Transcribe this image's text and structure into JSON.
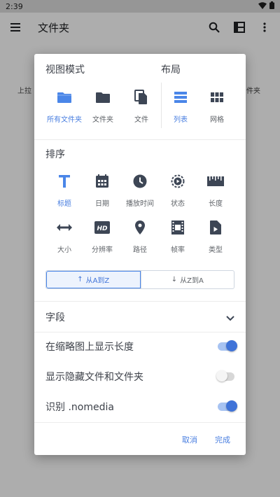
{
  "status_bar": {
    "time": "2:39",
    "icons": [
      "wifi-icon",
      "battery-icon"
    ]
  },
  "app_bar": {
    "title": "文件夹",
    "icons": [
      "menu-icon",
      "search-icon",
      "layout-icon",
      "more-vert-icon"
    ]
  },
  "background": {
    "left_text": "上拉",
    "right_text": "件夹"
  },
  "dialog": {
    "view_mode": {
      "title": "视图模式",
      "items": [
        {
          "label": "所有文件夹",
          "icon": "folder-filled-icon",
          "active": true
        },
        {
          "label": "文件夹",
          "icon": "folder-icon",
          "active": false
        },
        {
          "label": "文件",
          "icon": "file-copy-icon",
          "active": false
        }
      ]
    },
    "layout": {
      "title": "布局",
      "items": [
        {
          "label": "列表",
          "icon": "list-icon",
          "active": true
        },
        {
          "label": "网格",
          "icon": "grid-icon",
          "active": false
        }
      ]
    },
    "sort": {
      "title": "排序",
      "items": [
        {
          "label": "标题",
          "icon": "title-icon",
          "active": true
        },
        {
          "label": "日期",
          "icon": "calendar-icon",
          "active": false
        },
        {
          "label": "播放时间",
          "icon": "clock-icon",
          "active": false
        },
        {
          "label": "状态",
          "icon": "status-icon",
          "active": false
        },
        {
          "label": "长度",
          "icon": "ruler-icon",
          "active": false
        },
        {
          "label": "大小",
          "icon": "size-icon",
          "active": false
        },
        {
          "label": "分辨率",
          "icon": "hd-icon",
          "active": false
        },
        {
          "label": "路径",
          "icon": "location-icon",
          "active": false
        },
        {
          "label": "帧率",
          "icon": "film-icon",
          "active": false
        },
        {
          "label": "类型",
          "icon": "video-file-icon",
          "active": false
        }
      ],
      "order": {
        "asc": "从A到Z",
        "desc": "从Z到A",
        "selected": "asc"
      }
    },
    "fields": {
      "label": "字段"
    },
    "toggles": [
      {
        "label": "在缩略图上显示长度",
        "on": true
      },
      {
        "label": "显示隐藏文件和文件夹",
        "on": false
      },
      {
        "label": "识别 .nomedia",
        "on": true
      }
    ],
    "buttons": {
      "cancel": "取消",
      "done": "完成"
    }
  },
  "colors": {
    "accent": "#3f73d8",
    "icon": "#3d4655",
    "scrim": "rgba(0,0,0,0.32)"
  }
}
